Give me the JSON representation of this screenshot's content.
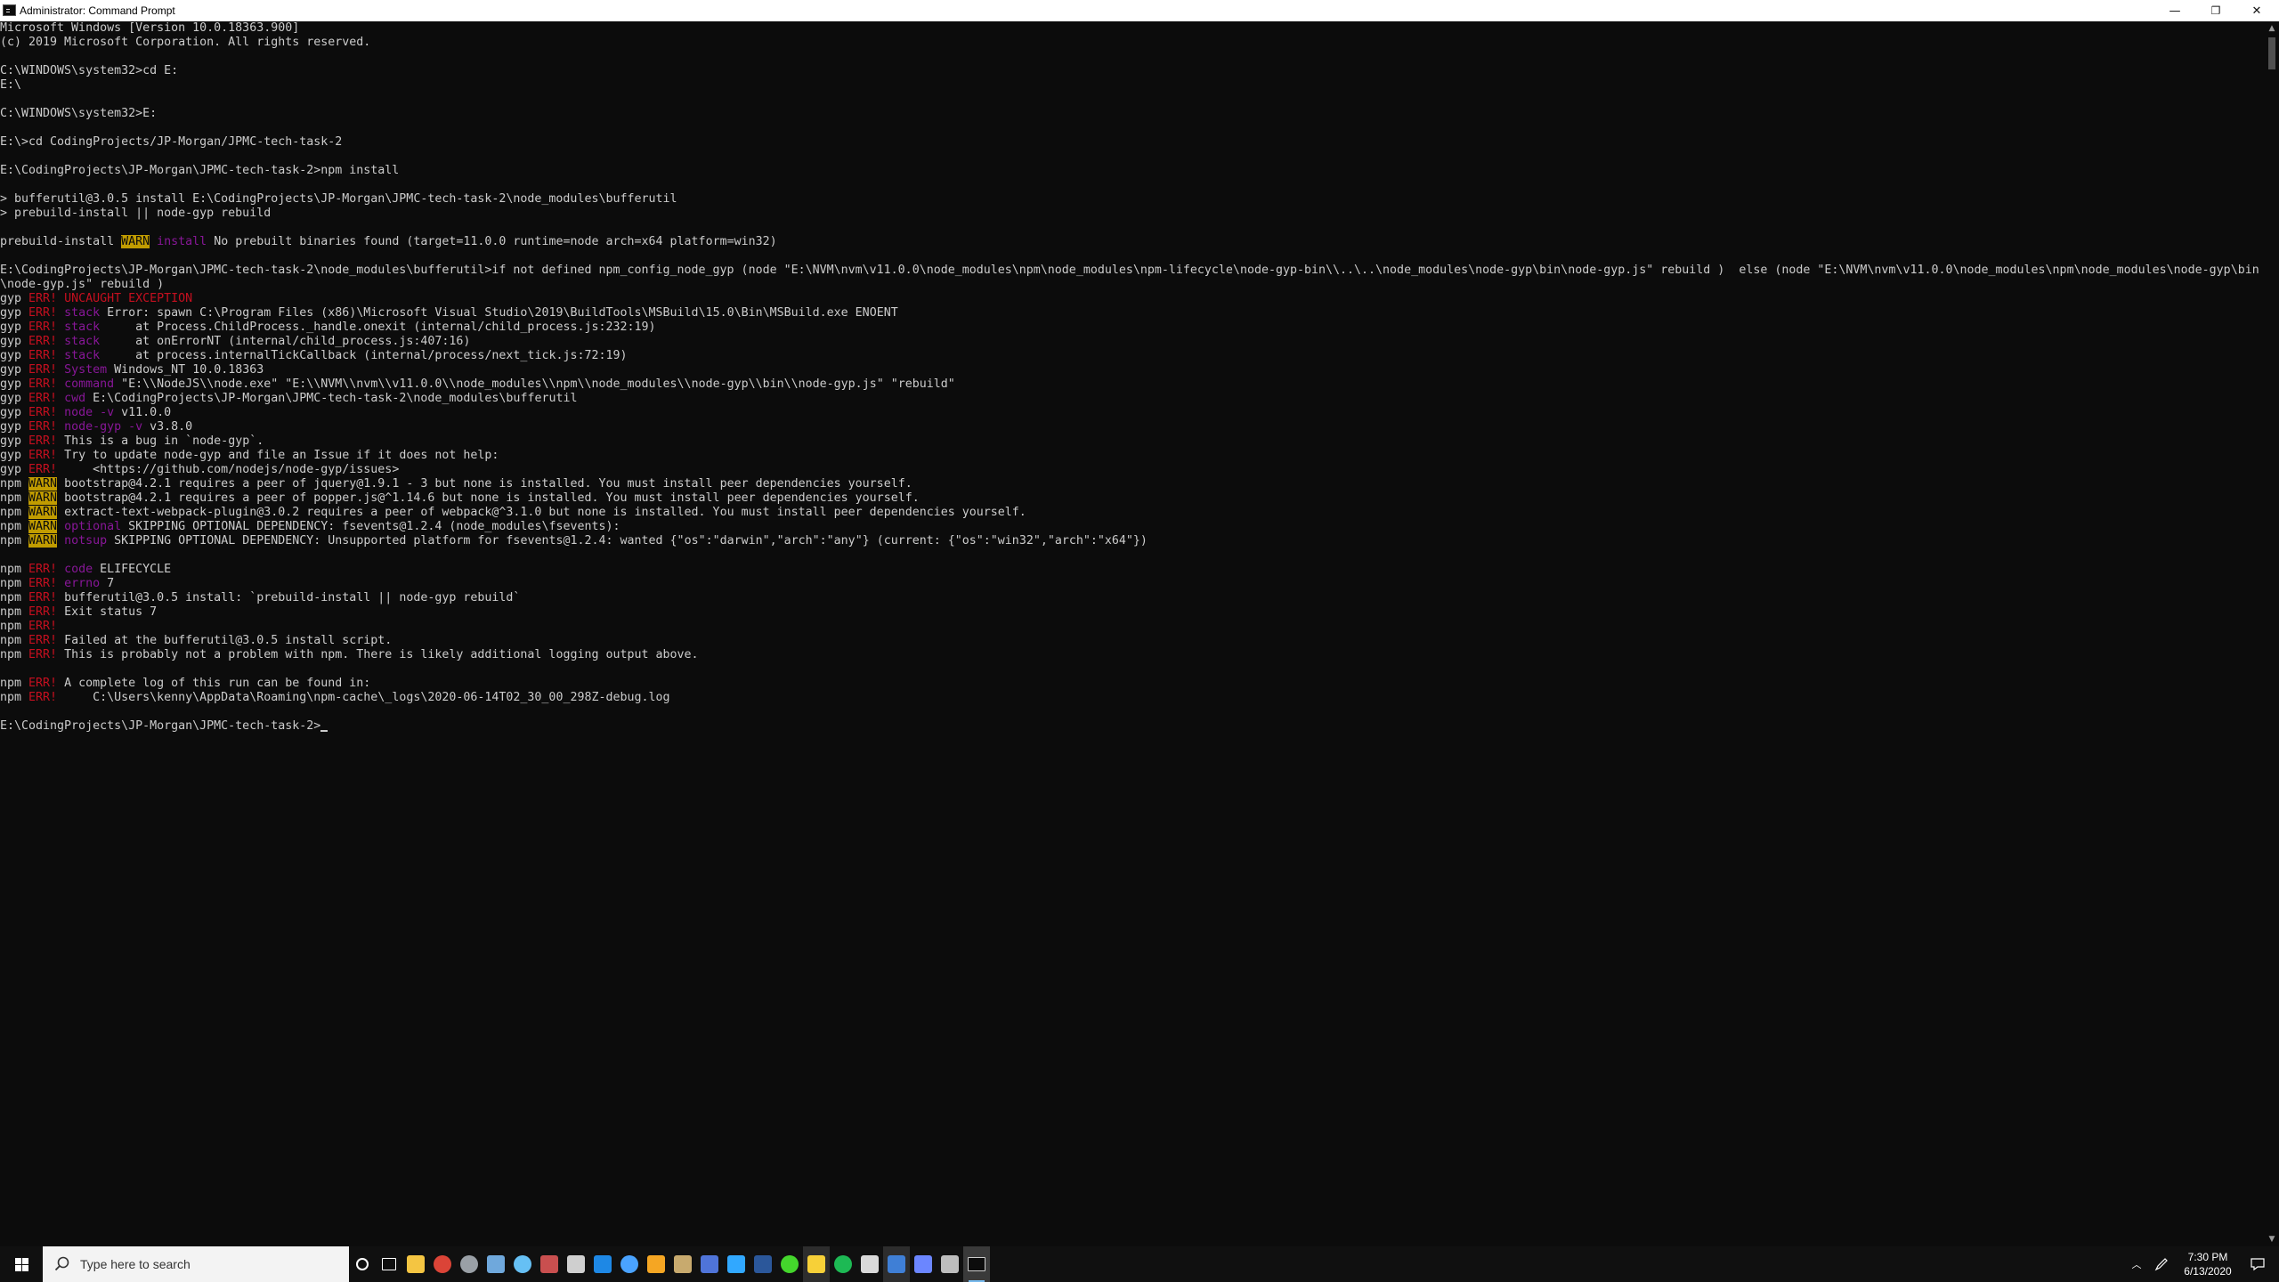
{
  "window": {
    "title": "Administrator: Command Prompt",
    "minimize_glyph": "—",
    "restore_glyph": "❐",
    "close_glyph": "✕"
  },
  "colors": {
    "background": "#0c0c0c",
    "text": "#cccccc",
    "err": "#c50f1f",
    "magenta": "#881798",
    "warn_bg": "#c19c00"
  },
  "console": {
    "lines": [
      {
        "row": 0,
        "segs": [
          {
            "t": "Microsoft Windows [Version 10.0.18363.900]"
          }
        ]
      },
      {
        "row": 1,
        "segs": [
          {
            "t": "(c) 2019 Microsoft Corporation. All rights reserved."
          }
        ]
      },
      {
        "row": 3,
        "segs": [
          {
            "t": "C:\\WINDOWS\\system32>cd E:"
          }
        ]
      },
      {
        "row": 4,
        "segs": [
          {
            "t": "E:\\"
          }
        ]
      },
      {
        "row": 6,
        "segs": [
          {
            "t": "C:\\WINDOWS\\system32>E:"
          }
        ]
      },
      {
        "row": 8,
        "segs": [
          {
            "t": "E:\\>cd CodingProjects/JP-Morgan/JPMC-tech-task-2"
          }
        ]
      },
      {
        "row": 10,
        "segs": [
          {
            "t": "E:\\CodingProjects\\JP-Morgan\\JPMC-tech-task-2>npm install"
          }
        ]
      },
      {
        "row": 12,
        "segs": [
          {
            "t": "> bufferutil@3.0.5 install E:\\CodingProjects\\JP-Morgan\\JPMC-tech-task-2\\node_modules\\bufferutil"
          }
        ]
      },
      {
        "row": 13,
        "segs": [
          {
            "t": "> prebuild-install || node-gyp rebuild"
          }
        ]
      },
      {
        "row": 15,
        "segs": [
          {
            "t": "prebuild-install "
          },
          {
            "t": "WARN",
            "c": "warn"
          },
          {
            "t": " "
          },
          {
            "t": "install",
            "c": "mag"
          },
          {
            "t": " No prebuilt binaries found (target=11.0.0 runtime=node arch=x64 platform=win32)"
          }
        ]
      },
      {
        "row": 17,
        "segs": [
          {
            "t": "E:\\CodingProjects\\JP-Morgan\\JPMC-tech-task-2\\node_modules\\bufferutil>if not defined npm_config_node_gyp (node \"E:\\NVM\\nvm\\v11.0.0\\node_modules\\npm\\node_modules\\npm-lifecycle\\node-gyp-bin\\\\..\\..\\node_modules\\node-gyp\\bin\\node-gyp.js\" rebuild )  else (node \"E:\\NVM\\nvm\\v11.0.0\\node_modules\\npm\\node_modules\\node-gyp\\bin"
          }
        ]
      },
      {
        "row": 18,
        "segs": [
          {
            "t": "\\node-gyp.js\" rebuild )"
          }
        ]
      },
      {
        "row": 19,
        "segs": [
          {
            "t": "gyp "
          },
          {
            "t": "ERR!",
            "c": "err"
          },
          {
            "t": " "
          },
          {
            "t": "UNCAUGHT EXCEPTION",
            "c": "err"
          }
        ]
      },
      {
        "row": 20,
        "segs": [
          {
            "t": "gyp "
          },
          {
            "t": "ERR!",
            "c": "err"
          },
          {
            "t": " "
          },
          {
            "t": "stack",
            "c": "mag"
          },
          {
            "t": " Error: spawn C:\\Program Files (x86)\\Microsoft Visual Studio\\2019\\BuildTools\\MSBuild\\15.0\\Bin\\MSBuild.exe ENOENT"
          }
        ]
      },
      {
        "row": 21,
        "segs": [
          {
            "t": "gyp "
          },
          {
            "t": "ERR!",
            "c": "err"
          },
          {
            "t": " "
          },
          {
            "t": "stack",
            "c": "mag"
          },
          {
            "t": "     at Process.ChildProcess._handle.onexit (internal/child_process.js:232:19)"
          }
        ]
      },
      {
        "row": 22,
        "segs": [
          {
            "t": "gyp "
          },
          {
            "t": "ERR!",
            "c": "err"
          },
          {
            "t": " "
          },
          {
            "t": "stack",
            "c": "mag"
          },
          {
            "t": "     at onErrorNT (internal/child_process.js:407:16)"
          }
        ]
      },
      {
        "row": 23,
        "segs": [
          {
            "t": "gyp "
          },
          {
            "t": "ERR!",
            "c": "err"
          },
          {
            "t": " "
          },
          {
            "t": "stack",
            "c": "mag"
          },
          {
            "t": "     at process.internalTickCallback (internal/process/next_tick.js:72:19)"
          }
        ]
      },
      {
        "row": 24,
        "segs": [
          {
            "t": "gyp "
          },
          {
            "t": "ERR!",
            "c": "err"
          },
          {
            "t": " "
          },
          {
            "t": "System",
            "c": "mag"
          },
          {
            "t": " Windows_NT 10.0.18363"
          }
        ]
      },
      {
        "row": 25,
        "segs": [
          {
            "t": "gyp "
          },
          {
            "t": "ERR!",
            "c": "err"
          },
          {
            "t": " "
          },
          {
            "t": "command",
            "c": "mag"
          },
          {
            "t": " \"E:\\\\NodeJS\\\\node.exe\" \"E:\\\\NVM\\\\nvm\\\\v11.0.0\\\\node_modules\\\\npm\\\\node_modules\\\\node-gyp\\\\bin\\\\node-gyp.js\" \"rebuild\""
          }
        ]
      },
      {
        "row": 26,
        "segs": [
          {
            "t": "gyp "
          },
          {
            "t": "ERR!",
            "c": "err"
          },
          {
            "t": " "
          },
          {
            "t": "cwd",
            "c": "mag"
          },
          {
            "t": " E:\\CodingProjects\\JP-Morgan\\JPMC-tech-task-2\\node_modules\\bufferutil"
          }
        ]
      },
      {
        "row": 27,
        "segs": [
          {
            "t": "gyp "
          },
          {
            "t": "ERR!",
            "c": "err"
          },
          {
            "t": " "
          },
          {
            "t": "node -v",
            "c": "mag"
          },
          {
            "t": " v11.0.0"
          }
        ]
      },
      {
        "row": 28,
        "segs": [
          {
            "t": "gyp "
          },
          {
            "t": "ERR!",
            "c": "err"
          },
          {
            "t": " "
          },
          {
            "t": "node-gyp -v",
            "c": "mag"
          },
          {
            "t": " v3.8.0"
          }
        ]
      },
      {
        "row": 29,
        "segs": [
          {
            "t": "gyp "
          },
          {
            "t": "ERR!",
            "c": "err"
          },
          {
            "t": " This is a bug in `node-gyp`."
          }
        ]
      },
      {
        "row": 30,
        "segs": [
          {
            "t": "gyp "
          },
          {
            "t": "ERR!",
            "c": "err"
          },
          {
            "t": " Try to update node-gyp and file an Issue if it does not help:"
          }
        ]
      },
      {
        "row": 31,
        "segs": [
          {
            "t": "gyp "
          },
          {
            "t": "ERR!",
            "c": "err"
          },
          {
            "t": "     <https://github.com/nodejs/node-gyp/issues>"
          }
        ]
      },
      {
        "row": 32,
        "segs": [
          {
            "t": "npm "
          },
          {
            "t": "WARN",
            "c": "warn"
          },
          {
            "t": " bootstrap@4.2.1 requires a peer of jquery@1.9.1 - 3 but none is installed. You must install peer dependencies yourself."
          }
        ]
      },
      {
        "row": 33,
        "segs": [
          {
            "t": "npm "
          },
          {
            "t": "WARN",
            "c": "warn"
          },
          {
            "t": " bootstrap@4.2.1 requires a peer of popper.js@^1.14.6 but none is installed. You must install peer dependencies yourself."
          }
        ]
      },
      {
        "row": 34,
        "segs": [
          {
            "t": "npm "
          },
          {
            "t": "WARN",
            "c": "warn"
          },
          {
            "t": " extract-text-webpack-plugin@3.0.2 requires a peer of webpack@^3.1.0 but none is installed. You must install peer dependencies yourself."
          }
        ]
      },
      {
        "row": 35,
        "segs": [
          {
            "t": "npm "
          },
          {
            "t": "WARN",
            "c": "warn"
          },
          {
            "t": " "
          },
          {
            "t": "optional",
            "c": "mag"
          },
          {
            "t": " SKIPPING OPTIONAL DEPENDENCY: fsevents@1.2.4 (node_modules\\fsevents):"
          }
        ]
      },
      {
        "row": 36,
        "segs": [
          {
            "t": "npm "
          },
          {
            "t": "WARN",
            "c": "warn"
          },
          {
            "t": " "
          },
          {
            "t": "notsup",
            "c": "mag"
          },
          {
            "t": " SKIPPING OPTIONAL DEPENDENCY: Unsupported platform for fsevents@1.2.4: wanted {\"os\":\"darwin\",\"arch\":\"any\"} (current: {\"os\":\"win32\",\"arch\":\"x64\"})"
          }
        ]
      },
      {
        "row": 38,
        "segs": [
          {
            "t": "npm "
          },
          {
            "t": "ERR!",
            "c": "err"
          },
          {
            "t": " "
          },
          {
            "t": "code",
            "c": "mag"
          },
          {
            "t": " ELIFECYCLE"
          }
        ]
      },
      {
        "row": 39,
        "segs": [
          {
            "t": "npm "
          },
          {
            "t": "ERR!",
            "c": "err"
          },
          {
            "t": " "
          },
          {
            "t": "errno",
            "c": "mag"
          },
          {
            "t": " 7"
          }
        ]
      },
      {
        "row": 40,
        "segs": [
          {
            "t": "npm "
          },
          {
            "t": "ERR!",
            "c": "err"
          },
          {
            "t": " bufferutil@3.0.5 install: `prebuild-install || node-gyp rebuild`"
          }
        ]
      },
      {
        "row": 41,
        "segs": [
          {
            "t": "npm "
          },
          {
            "t": "ERR!",
            "c": "err"
          },
          {
            "t": " Exit status 7"
          }
        ]
      },
      {
        "row": 42,
        "segs": [
          {
            "t": "npm "
          },
          {
            "t": "ERR!",
            "c": "err"
          }
        ]
      },
      {
        "row": 43,
        "segs": [
          {
            "t": "npm "
          },
          {
            "t": "ERR!",
            "c": "err"
          },
          {
            "t": " Failed at the bufferutil@3.0.5 install script."
          }
        ]
      },
      {
        "row": 44,
        "segs": [
          {
            "t": "npm "
          },
          {
            "t": "ERR!",
            "c": "err"
          },
          {
            "t": " This is probably not a problem with npm. There is likely additional logging output above."
          }
        ]
      },
      {
        "row": 46,
        "segs": [
          {
            "t": "npm "
          },
          {
            "t": "ERR!",
            "c": "err"
          },
          {
            "t": " A complete log of this run can be found in:"
          }
        ]
      },
      {
        "row": 47,
        "segs": [
          {
            "t": "npm "
          },
          {
            "t": "ERR!",
            "c": "err"
          },
          {
            "t": "     C:\\Users\\kenny\\AppData\\Roaming\\npm-cache\\_logs\\2020-06-14T02_30_00_298Z-debug.log"
          }
        ]
      },
      {
        "row": 49,
        "segs": [
          {
            "t": "E:\\CodingProjects\\JP-Morgan\\JPMC-tech-task-2>"
          }
        ]
      }
    ]
  },
  "taskbar": {
    "search_placeholder": "Type here to search",
    "clock_time": "7:30 PM",
    "clock_date": "6/13/2020",
    "apps": [
      {
        "name": "cortana-icon",
        "color": "#ffffff"
      },
      {
        "name": "task-view-icon",
        "color": "#ffffff"
      },
      {
        "name": "file-explorer-icon",
        "color": "#f4c542"
      },
      {
        "name": "chrome-icon",
        "color": "#db4437"
      },
      {
        "name": "steam-overlay-icon",
        "color": "#9aa0a6"
      },
      {
        "name": "windows-sandbox-icon",
        "color": "#6fa8dc"
      },
      {
        "name": "steam-icon",
        "color": "#66c0f4"
      },
      {
        "name": "mail-app-icon",
        "color": "#c94f4f"
      },
      {
        "name": "cloud-drive-icon",
        "color": "#cfcfcf"
      },
      {
        "name": "ubisoft-icon",
        "color": "#1e88e5"
      },
      {
        "name": "battlenet-icon",
        "color": "#4aa3ff"
      },
      {
        "name": "intellij-icon",
        "color": "#f5a623"
      },
      {
        "name": "league-icon",
        "color": "#c8aa6e"
      },
      {
        "name": "code-editor-icon",
        "color": "#4f74d9"
      },
      {
        "name": "photoshop-icon",
        "color": "#31a8ff"
      },
      {
        "name": "word-icon",
        "color": "#2b579a"
      },
      {
        "name": "razer-icon",
        "color": "#44d62c"
      },
      {
        "name": "sticky-notes-icon",
        "color": "#f7d038"
      },
      {
        "name": "spotify-icon",
        "color": "#1db954"
      },
      {
        "name": "file-manager-icon",
        "color": "#d9d9d9"
      },
      {
        "name": "teamspeak-icon",
        "color": "#3f7fd6"
      },
      {
        "name": "visual-studio-icon",
        "color": "#6b86ff"
      },
      {
        "name": "shortcut-app-icon",
        "color": "#bdbdbd"
      },
      {
        "name": "command-prompt-icon",
        "color": "#cccccc"
      }
    ]
  }
}
